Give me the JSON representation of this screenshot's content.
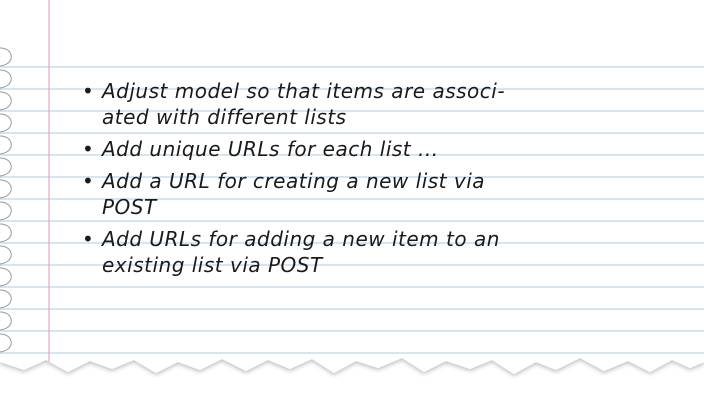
{
  "bullet_glyph": "•",
  "notes": [
    {
      "lines": [
        "Adjust model so that items are associ-",
        "ated with different lists"
      ]
    },
    {
      "lines": [
        "Add unique URLs for each list ..."
      ]
    },
    {
      "lines": [
        "Add a URL for creating a new list via",
        "POST"
      ]
    },
    {
      "lines": [
        "Add URLs for adding a new item to an",
        "existing list via POST"
      ]
    }
  ],
  "colors": {
    "paper": "#ffffff",
    "rule_line": "#b9d6ea",
    "margin_line": "#e6a9b9",
    "ink": "#1a1a1a",
    "background": "#ffffff"
  }
}
